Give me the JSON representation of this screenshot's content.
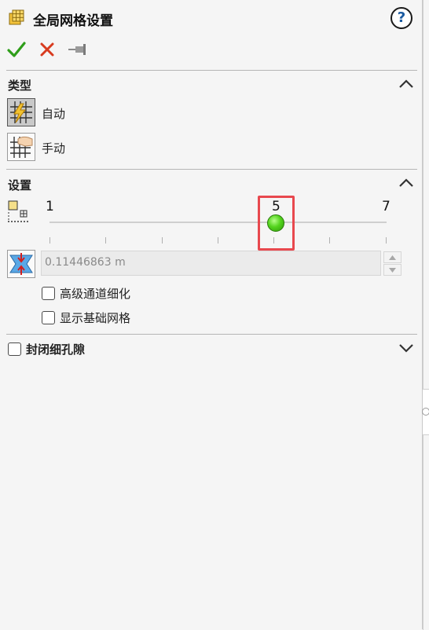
{
  "header": {
    "title": "全局网格设置",
    "help_label": "?"
  },
  "toolbar": {
    "ok_icon": "checkmark-icon",
    "cancel_icon": "close-icon",
    "pin_icon": "pushpin-icon",
    "ok_color": "#2f9e1a",
    "cancel_color": "#d83b1f"
  },
  "type_section": {
    "title": "类型",
    "options": [
      {
        "label": "自动",
        "icon": "auto-mesh-icon",
        "selected": true
      },
      {
        "label": "手动",
        "icon": "manual-mesh-icon",
        "selected": false
      }
    ]
  },
  "settings_section": {
    "title": "设置",
    "slider": {
      "min_label": "1",
      "max_label": "7",
      "value_label": "5",
      "min": 1,
      "max": 7,
      "value": 5,
      "highlight_color": "#e8484e",
      "thumb_color": "#54d41e"
    },
    "min_gap": {
      "value": "0.11446863 m"
    },
    "checkboxes": [
      {
        "label": "高级通道细化",
        "checked": false
      },
      {
        "label": "显示基础网格",
        "checked": false
      }
    ]
  },
  "close_gaps_section": {
    "label": "封闭细孔隙",
    "checked": false
  }
}
